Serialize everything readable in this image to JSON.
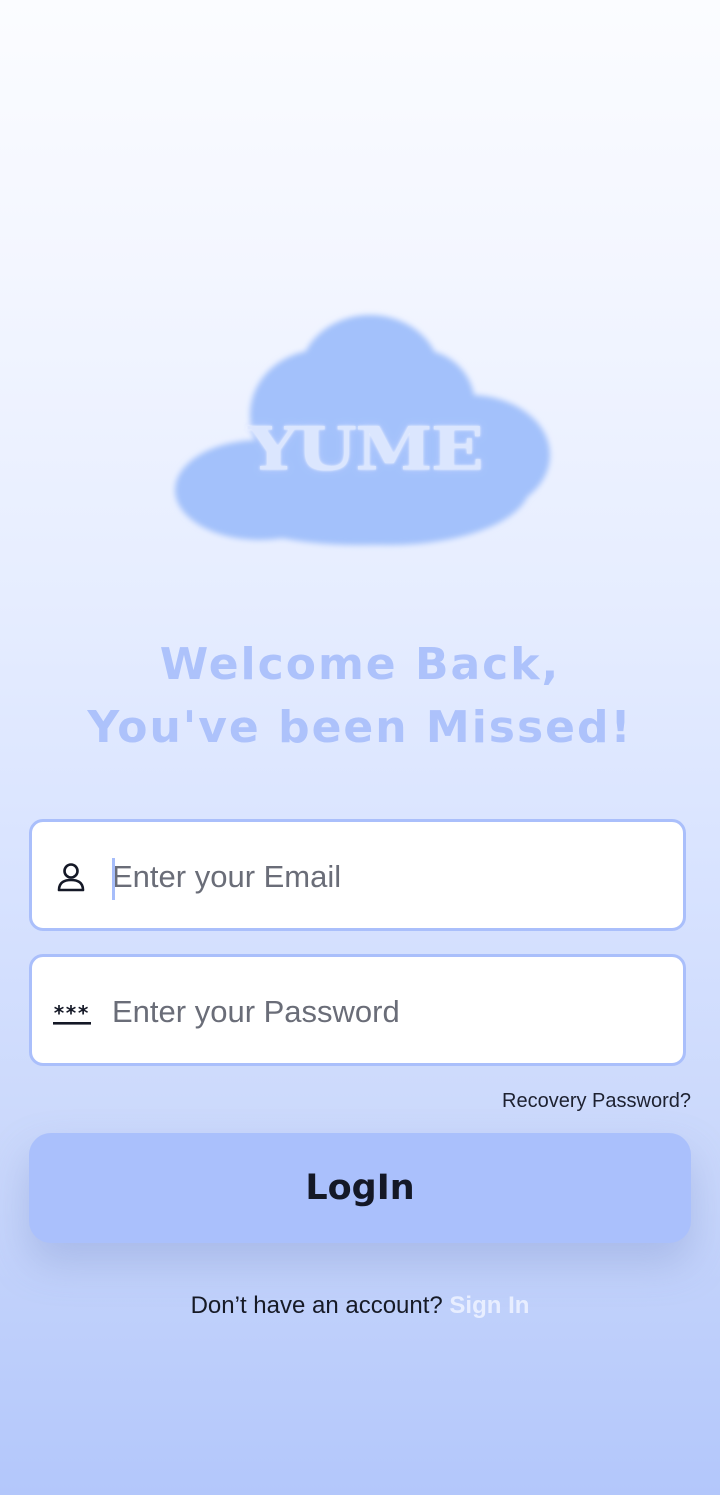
{
  "logo": {
    "text": "YUME"
  },
  "welcome": {
    "line1": "Welcome Back,",
    "line2": "You've been Missed!"
  },
  "email_field": {
    "placeholder": "Enter your Email",
    "value": "",
    "icon": "user-icon"
  },
  "password_field": {
    "placeholder": "Enter your Password",
    "value": "",
    "icon": "password-icon"
  },
  "recovery": {
    "label": "Recovery Password?"
  },
  "login_button": {
    "label": "LogIn"
  },
  "signup": {
    "prompt": "Don’t have an account? ",
    "link_label": "Sign In"
  },
  "colors": {
    "accent": "#aac0fc",
    "heading": "#adc2fb",
    "field_border": "#aabffb",
    "link": "#e8eeff"
  }
}
